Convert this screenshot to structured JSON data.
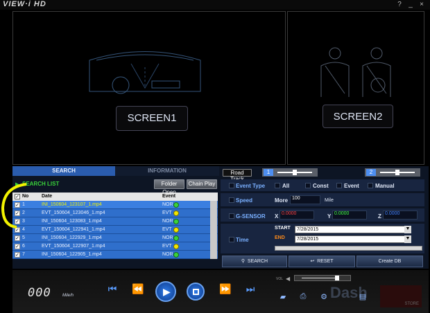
{
  "window": {
    "title": "VIEW·i HD",
    "help": "?",
    "minimize": "_",
    "close": "×"
  },
  "screens": {
    "screen1": "SCREEN1",
    "screen2": "SCREEN2"
  },
  "tabs": {
    "search": "SEARCH",
    "information": "INFORMATION"
  },
  "search_list": {
    "title": "SEARCH LIST",
    "folder_open": "Folder Open",
    "chain_play": "Chain Play"
  },
  "table": {
    "headers": {
      "no": "No",
      "date": "Date",
      "event": "Event"
    },
    "rows": [
      {
        "no": "1",
        "date": "INI_150604_123107_1.mp4",
        "event": "NOR",
        "status": "green"
      },
      {
        "no": "2",
        "date": "EVT_150604_123046_1.mp4",
        "event": "EVT",
        "status": "yellow"
      },
      {
        "no": "3",
        "date": "INI_150604_123083_1.mp4",
        "event": "NOR",
        "status": "green"
      },
      {
        "no": "4",
        "date": "EVT_150604_122941_1.mp4",
        "event": "EVT",
        "status": "yellow"
      },
      {
        "no": "5",
        "date": "INI_150604_122929_1.mp4",
        "event": "NOR",
        "status": "green"
      },
      {
        "no": "6",
        "date": "EVT_150604_122907_1.mp4",
        "event": "EVT",
        "status": "yellow"
      },
      {
        "no": "7",
        "date": "INI_150604_122905_1.mp4",
        "event": "NOR",
        "status": "green"
      }
    ]
  },
  "road_track": {
    "label": "Road Track",
    "slot1": "1",
    "slot2": "2"
  },
  "filters": {
    "event_type": {
      "label": "Event Type",
      "all": "All",
      "const": "Const",
      "event": "Event",
      "manual": "Manual"
    },
    "speed": {
      "label": "Speed",
      "more": "More",
      "value": "100",
      "unit": "Mile"
    },
    "gsensor": {
      "label": "G-SENSOR",
      "x": "X",
      "x_val": "0.0000",
      "y": "Y",
      "y_val": "0.0000",
      "z": "Z",
      "z_val": "0.0000"
    },
    "time": {
      "label": "Time",
      "start": "START",
      "start_date": "7/28/2015",
      "end": "END",
      "end_date": "7/28/2015"
    }
  },
  "actions": {
    "search": "SEARCH",
    "reset": "RESET",
    "create_db": "Create DB"
  },
  "footer": {
    "speed": "000",
    "speed_unit": "Mile/h",
    "vol": "VOL",
    "brand": "Dash",
    "store": "STORE"
  },
  "colors": {
    "accent": "#2f6fcc",
    "panel": "#0d1524",
    "gsensor_x": "#ff4040",
    "gsensor_y": "#40ff40",
    "gsensor_z": "#4080ff",
    "highlight": "#f2f200"
  }
}
